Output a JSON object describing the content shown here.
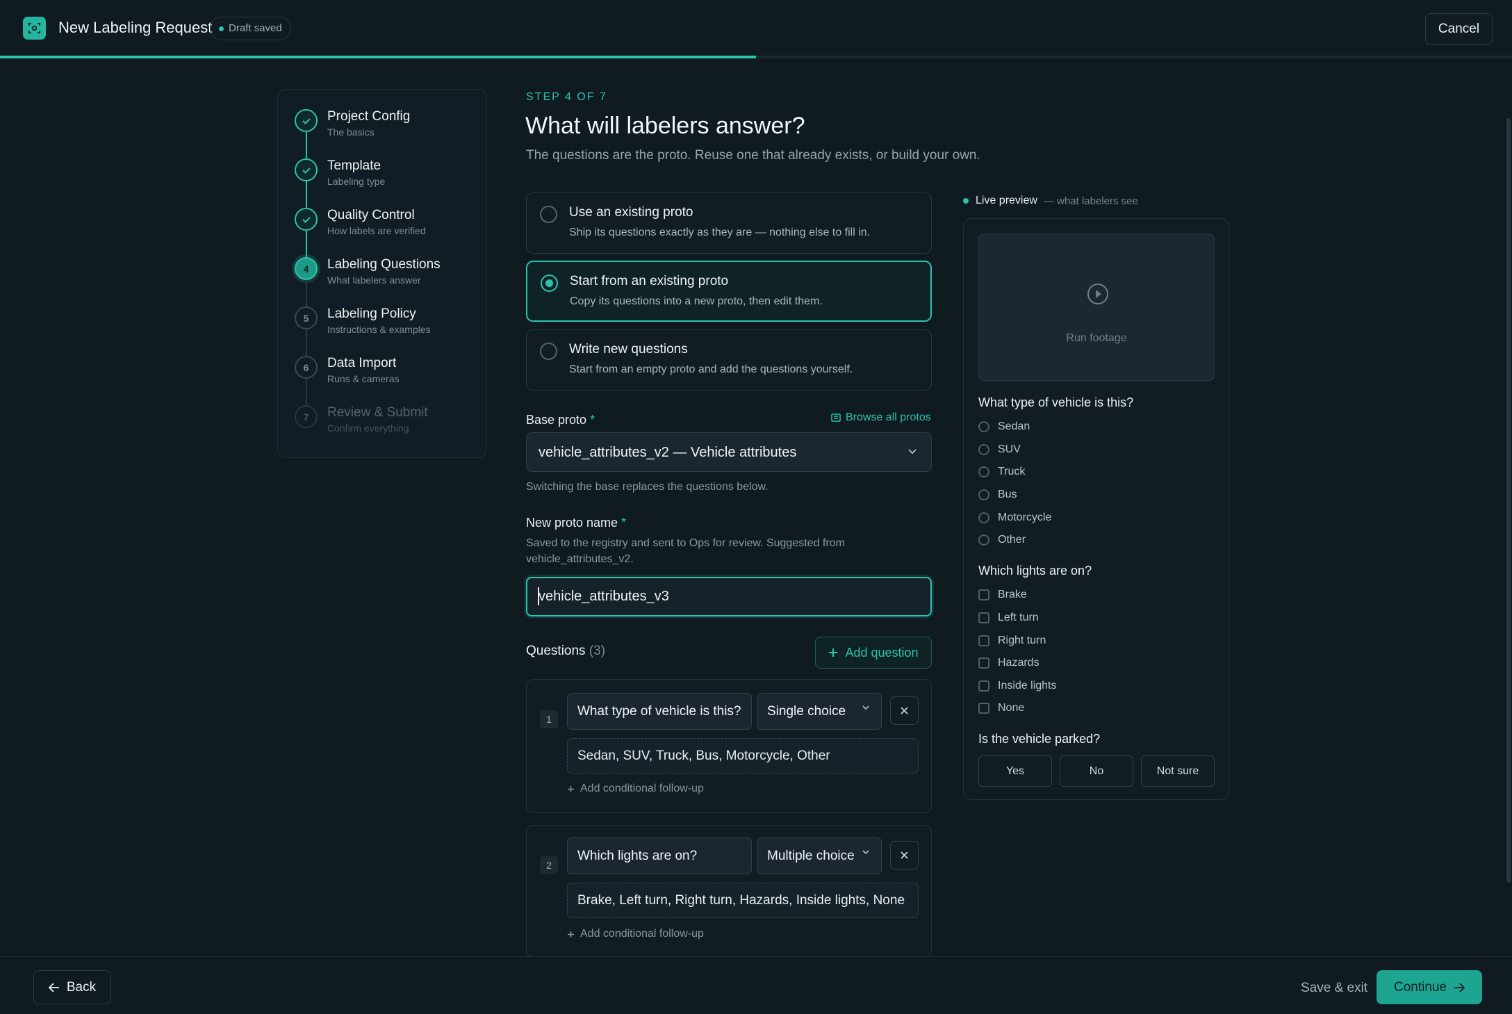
{
  "header": {
    "title": "New Labeling Request",
    "draft_status": "Draft saved",
    "cancel_label": "Cancel",
    "progress": 0.5
  },
  "stepper": {
    "steps": [
      {
        "number": "1",
        "title": "Project Config",
        "subtitle": "The basics",
        "state": "done"
      },
      {
        "number": "2",
        "title": "Template",
        "subtitle": "Labeling type",
        "state": "done"
      },
      {
        "number": "3",
        "title": "Quality Control",
        "subtitle": "How labels are verified",
        "state": "done"
      },
      {
        "number": "4",
        "title": "Labeling Questions",
        "subtitle": "What labelers answer",
        "state": "active"
      },
      {
        "number": "5",
        "title": "Labeling Policy",
        "subtitle": "Instructions & examples",
        "state": "todo"
      },
      {
        "number": "6",
        "title": "Data Import",
        "subtitle": "Runs & cameras",
        "state": "todo"
      },
      {
        "number": "7",
        "title": "Review & Submit",
        "subtitle": "Confirm everything",
        "state": "muted"
      }
    ]
  },
  "main": {
    "step_label": "STEP 4 OF 7",
    "title": "What will labelers answer?",
    "description": "The questions are the proto. Reuse one that already exists, or build your own.",
    "options": [
      {
        "title": "Use an existing proto",
        "description": "Ship its questions exactly as they are — nothing else to fill in.",
        "selected": false
      },
      {
        "title": "Start from an existing proto",
        "description": "Copy its questions into a new proto, then edit them.",
        "selected": true
      },
      {
        "title": "Write new questions",
        "description": "Start from an empty proto and add the questions yourself.",
        "selected": false
      }
    ],
    "base_proto": {
      "label": "Base proto",
      "required_mark": "*",
      "browse_label": "Browse all protos",
      "value": "vehicle_attributes_v2 — Vehicle attributes",
      "help": "Switching the base replaces the questions below."
    },
    "new_proto": {
      "label": "New proto name",
      "required_mark": "*",
      "help": "Saved to the registry and sent to Ops for review. Suggested from vehicle_attributes_v2.",
      "value": "vehicle_attributes_v3"
    },
    "questions_header": {
      "label": "Questions",
      "count": "(3)",
      "add_label": "Add question"
    },
    "questions": [
      {
        "number": "1",
        "text": "What type of vehicle is this?",
        "type": "Single choice",
        "options": "Sedan, SUV, Truck, Bus, Motorcycle, Other",
        "followup": "Add conditional follow-up"
      },
      {
        "number": "2",
        "text": "Which lights are on?",
        "type": "Multiple choice",
        "options": "Brake, Left turn, Right turn, Hazards, Inside lights, None",
        "followup": "Add conditional follow-up"
      }
    ]
  },
  "preview": {
    "label": "Live preview",
    "sublabel": "— what labelers see",
    "video_label": "Run footage",
    "q1": {
      "text": "What type of vehicle is this?",
      "options": [
        "Sedan",
        "SUV",
        "Truck",
        "Bus",
        "Motorcycle",
        "Other"
      ]
    },
    "q2": {
      "text": "Which lights are on?",
      "options": [
        "Brake",
        "Left turn",
        "Right turn",
        "Hazards",
        "Inside lights",
        "None"
      ]
    },
    "q3": {
      "text": "Is the vehicle parked?",
      "options": [
        "Yes",
        "No",
        "Not sure"
      ]
    }
  },
  "footer": {
    "back_label": "Back",
    "save_exit_label": "Save & exit",
    "continue_label": "Continue"
  },
  "colors": {
    "accent": "#2cc3ad",
    "background": "#0f1a21",
    "card": "#111c23"
  }
}
